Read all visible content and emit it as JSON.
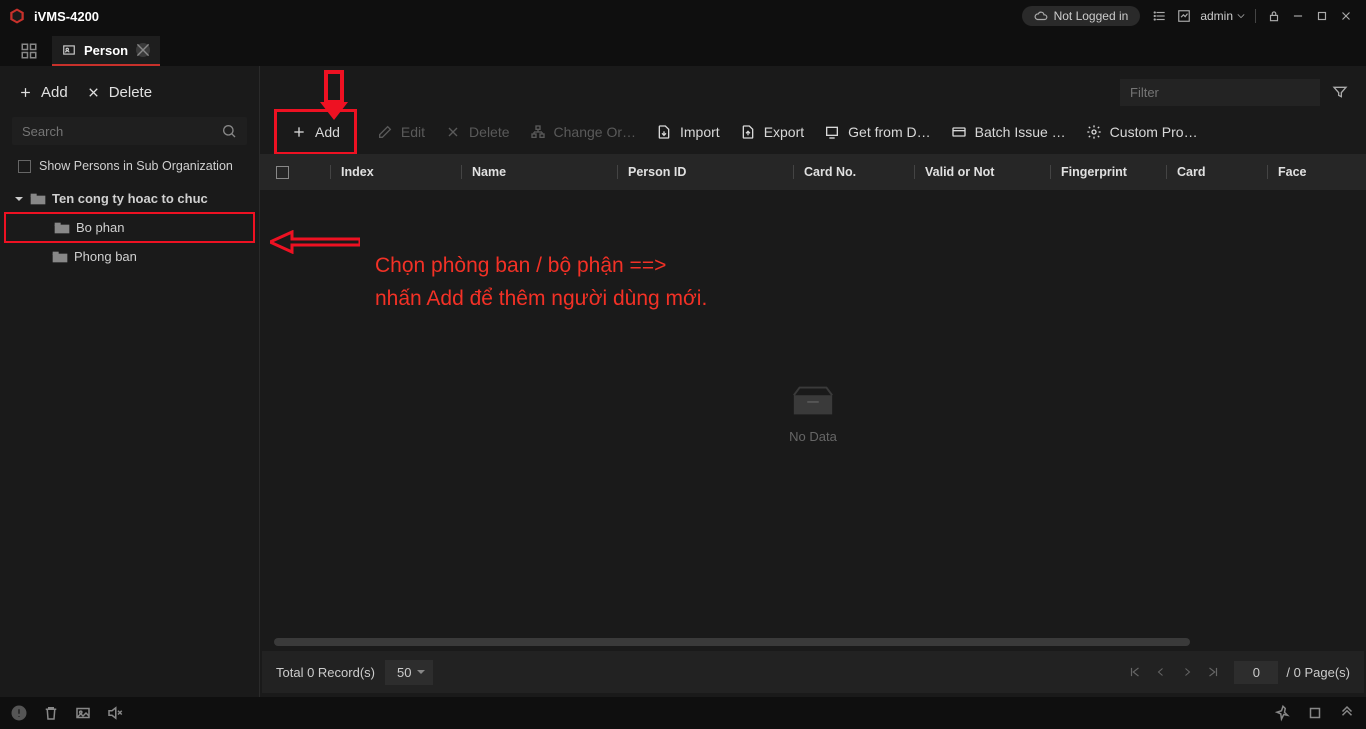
{
  "app": {
    "title": "iVMS-4200"
  },
  "titlebar": {
    "login_status": "Not Logged in",
    "user": "admin"
  },
  "tabs": {
    "active": "Person"
  },
  "sidebar": {
    "add": "Add",
    "delete": "Delete",
    "search_placeholder": "Search",
    "show_sub": "Show Persons in Sub Organization",
    "tree": {
      "root": "Ten cong ty hoac to chuc",
      "child1": "Bo phan",
      "child2": "Phong ban"
    }
  },
  "toolbar": {
    "add": "Add",
    "edit": "Edit",
    "delete": "Delete",
    "change": "Change Or…",
    "import": "Import",
    "export": "Export",
    "get_device": "Get from D…",
    "batch": "Batch Issue …",
    "custom": "Custom Pro…",
    "filter_placeholder": "Filter"
  },
  "table": {
    "cols": {
      "index": "Index",
      "name": "Name",
      "person_id": "Person ID",
      "card_no": "Card No.",
      "valid": "Valid or Not",
      "fingerprint": "Fingerprint",
      "card": "Card",
      "face": "Face"
    },
    "no_data": "No Data"
  },
  "pager": {
    "total_label": "Total 0 Record(s)",
    "page_size": "50",
    "current": "0",
    "pages_label": "/ 0 Page(s)"
  },
  "annotation": {
    "line1": "Chọn phòng ban / bộ phận ==>",
    "line2": "nhấn Add để thêm người dùng mới."
  }
}
